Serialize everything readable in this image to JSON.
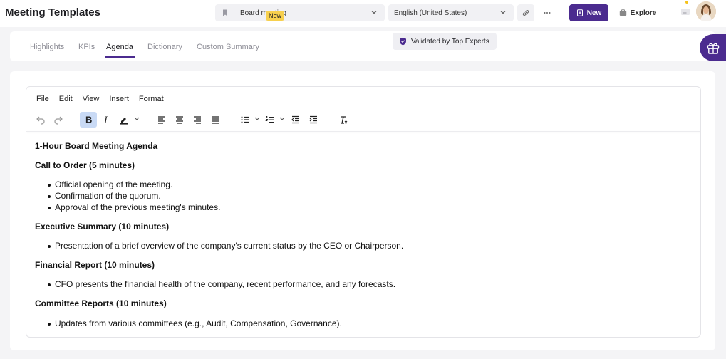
{
  "header": {
    "app_title": "Meeting Templates",
    "template_select": {
      "value": "Board meeting"
    },
    "language_select": {
      "value": "English (United States)"
    },
    "new_button_label": "New",
    "explore_button_label": "Explore"
  },
  "tabs": {
    "items": [
      {
        "label": "Highlights"
      },
      {
        "label": "KPIs"
      },
      {
        "label": "Agenda"
      },
      {
        "label": "Dictionary"
      },
      {
        "label": "Custom Summary"
      }
    ],
    "active": "Agenda",
    "new_badge": "New"
  },
  "validated_label": "Validated by Top Experts",
  "editor": {
    "menu": [
      "File",
      "Edit",
      "View",
      "Insert",
      "Format"
    ],
    "toolbar_icons": [
      "undo-icon",
      "redo-icon",
      "bold-icon",
      "italic-icon",
      "highlight-icon",
      "align-left-icon",
      "align-center-icon",
      "align-right-icon",
      "align-justify-icon",
      "bullet-list-icon",
      "numbered-list-icon",
      "outdent-icon",
      "indent-icon",
      "clear-format-icon"
    ],
    "active_format": "bold",
    "document": {
      "title": "1-Hour Board Meeting Agenda",
      "sections": [
        {
          "heading": "Call to Order (5 minutes)",
          "items": [
            "Official opening of the meeting.",
            "Confirmation of the quorum.",
            "Approval of the previous meeting's minutes."
          ]
        },
        {
          "heading": "Executive Summary (10 minutes)",
          "items": [
            "Presentation of a brief overview of the company's current status by the CEO or Chairperson."
          ]
        },
        {
          "heading": "Financial Report (10 minutes)",
          "items": [
            "CFO presents the financial health of the company, recent performance, and any forecasts."
          ]
        },
        {
          "heading": "Committee Reports (10 minutes)",
          "items": [
            "Updates from various committees (e.g., Audit, Compensation, Governance)."
          ]
        }
      ]
    }
  },
  "colors": {
    "accent": "#4b2b8f",
    "badge": "#f7d04e",
    "bold_active": "#c9daf5"
  }
}
